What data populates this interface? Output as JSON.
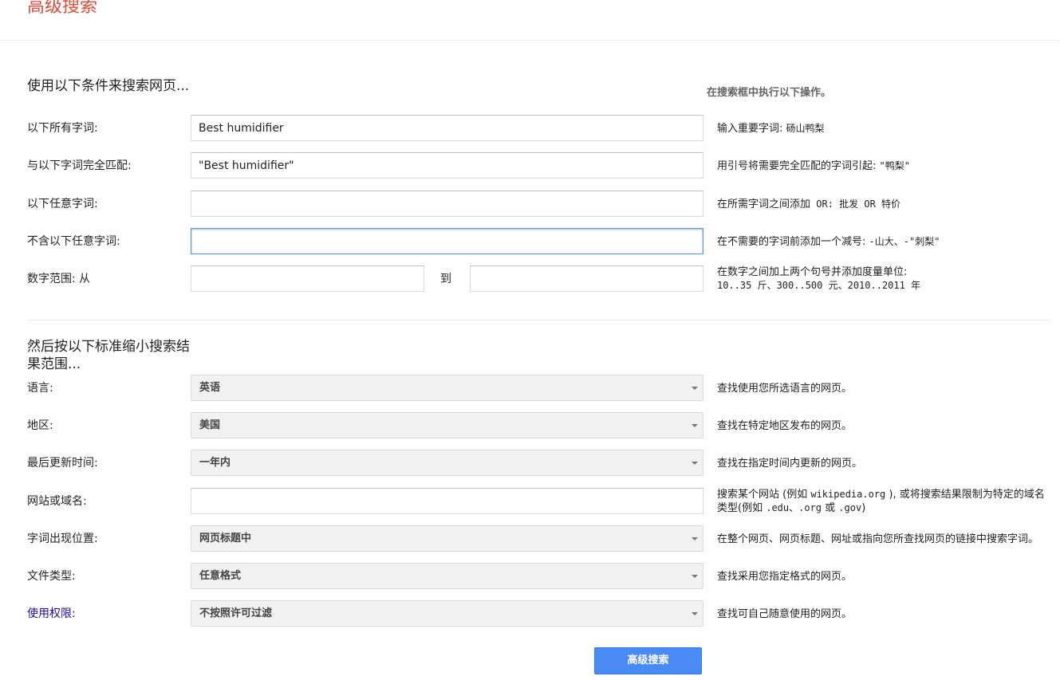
{
  "page_title": "高级搜索",
  "section1": {
    "heading": "使用以下条件来搜索网页...",
    "instructions_heading": "在搜索框中执行以下操作。",
    "rows": {
      "all_words": {
        "label": "以下所有字词:",
        "value": "Best humidifier",
        "hint_text": "输入重要字词: ",
        "hint_mono": "砀山鸭梨"
      },
      "exact_phrase": {
        "label": "与以下字词完全匹配:",
        "value": "\"Best humidifier\"",
        "hint_text": "用引号将需要完全匹配的字词引起: ",
        "hint_mono": "\"鸭梨\""
      },
      "any_words": {
        "label": "以下任意字词:",
        "value": "",
        "hint_text": "在所需字词之间添加",
        "hint_mono": " OR: 批发 OR 特价"
      },
      "none_words": {
        "label": "不含以下任意字词:",
        "value": "",
        "hint_text": "在不需要的字词前添加一个减号: ",
        "hint_mono": "-山大、-\"刺梨\""
      },
      "number_range": {
        "label": "数字范围: 从",
        "separator": "到",
        "from_value": "",
        "to_value": "",
        "hint_line1": "在数字之间加上两个句号并添加度量单位:",
        "hint_line2": "10..35 斤、300..500 元、2010..2011 年"
      }
    }
  },
  "section2": {
    "heading": "然后按以下标准缩小搜索结果范围...",
    "rows": {
      "language": {
        "label": "语言:",
        "value": "英语",
        "hint": "查找使用您所选语言的网页。"
      },
      "region": {
        "label": "地区:",
        "value": "美国",
        "hint": "查找在特定地区发布的网页。"
      },
      "last_update": {
        "label": "最后更新时间:",
        "value": "一年内",
        "hint": "查找在指定时间内更新的网页。"
      },
      "site_domain": {
        "label": "网站或域名:",
        "value": "",
        "hint_a": "搜索某个网站 (例如 ",
        "hint_mono1": "wikipedia.org",
        "hint_b": " ), 或将搜索结果限制为特定的域名类型(例如 ",
        "hint_mono2": ".edu、.org",
        "hint_c": " 或 ",
        "hint_mono3": ".gov",
        "hint_d": ")"
      },
      "term_position": {
        "label": "字词出现位置:",
        "value": "网页标题中",
        "hint": "在整个网页、网页标题、网址或指向您所查找网页的链接中搜索字词。"
      },
      "file_type": {
        "label": "文件类型:",
        "value": "任意格式",
        "hint": "查找采用您指定格式的网页。"
      },
      "usage_rights": {
        "label": "使用权限:",
        "value": "不按照许可过滤",
        "hint": "查找可自己随意使用的网页。"
      }
    }
  },
  "submit_label": "高级搜索",
  "colors": {
    "title": "#dd4b39",
    "link": "#1a0dab",
    "button": "#4a8af4",
    "focus_border": "#4d90fe"
  }
}
